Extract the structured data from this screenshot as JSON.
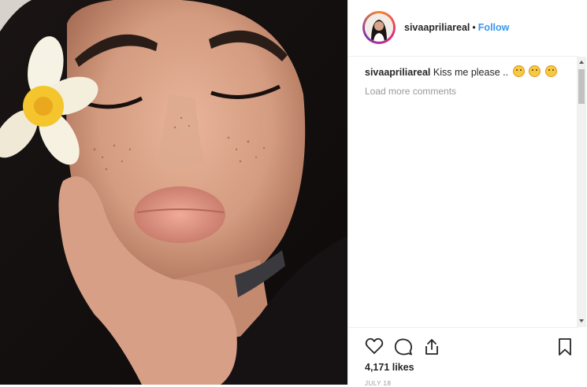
{
  "post": {
    "username": "sivaapriliareal",
    "follow_label": "Follow",
    "separator": "•",
    "caption_user": "sivaapriliareal",
    "caption_text": "Kiss me please ..",
    "caption_emojis": [
      "smiling-face-emoji",
      "kissing-face-emoji",
      "grinning-face-emoji"
    ],
    "load_more_label": "Load more comments",
    "likes": "4,171 likes",
    "date": "JULY 18"
  },
  "colors": {
    "link_blue": "#3897f0",
    "muted_gray": "#999999",
    "text": "#262626"
  },
  "icons": {
    "like": "heart-icon",
    "comment": "comment-icon",
    "share": "share-icon",
    "save": "bookmark-icon"
  }
}
